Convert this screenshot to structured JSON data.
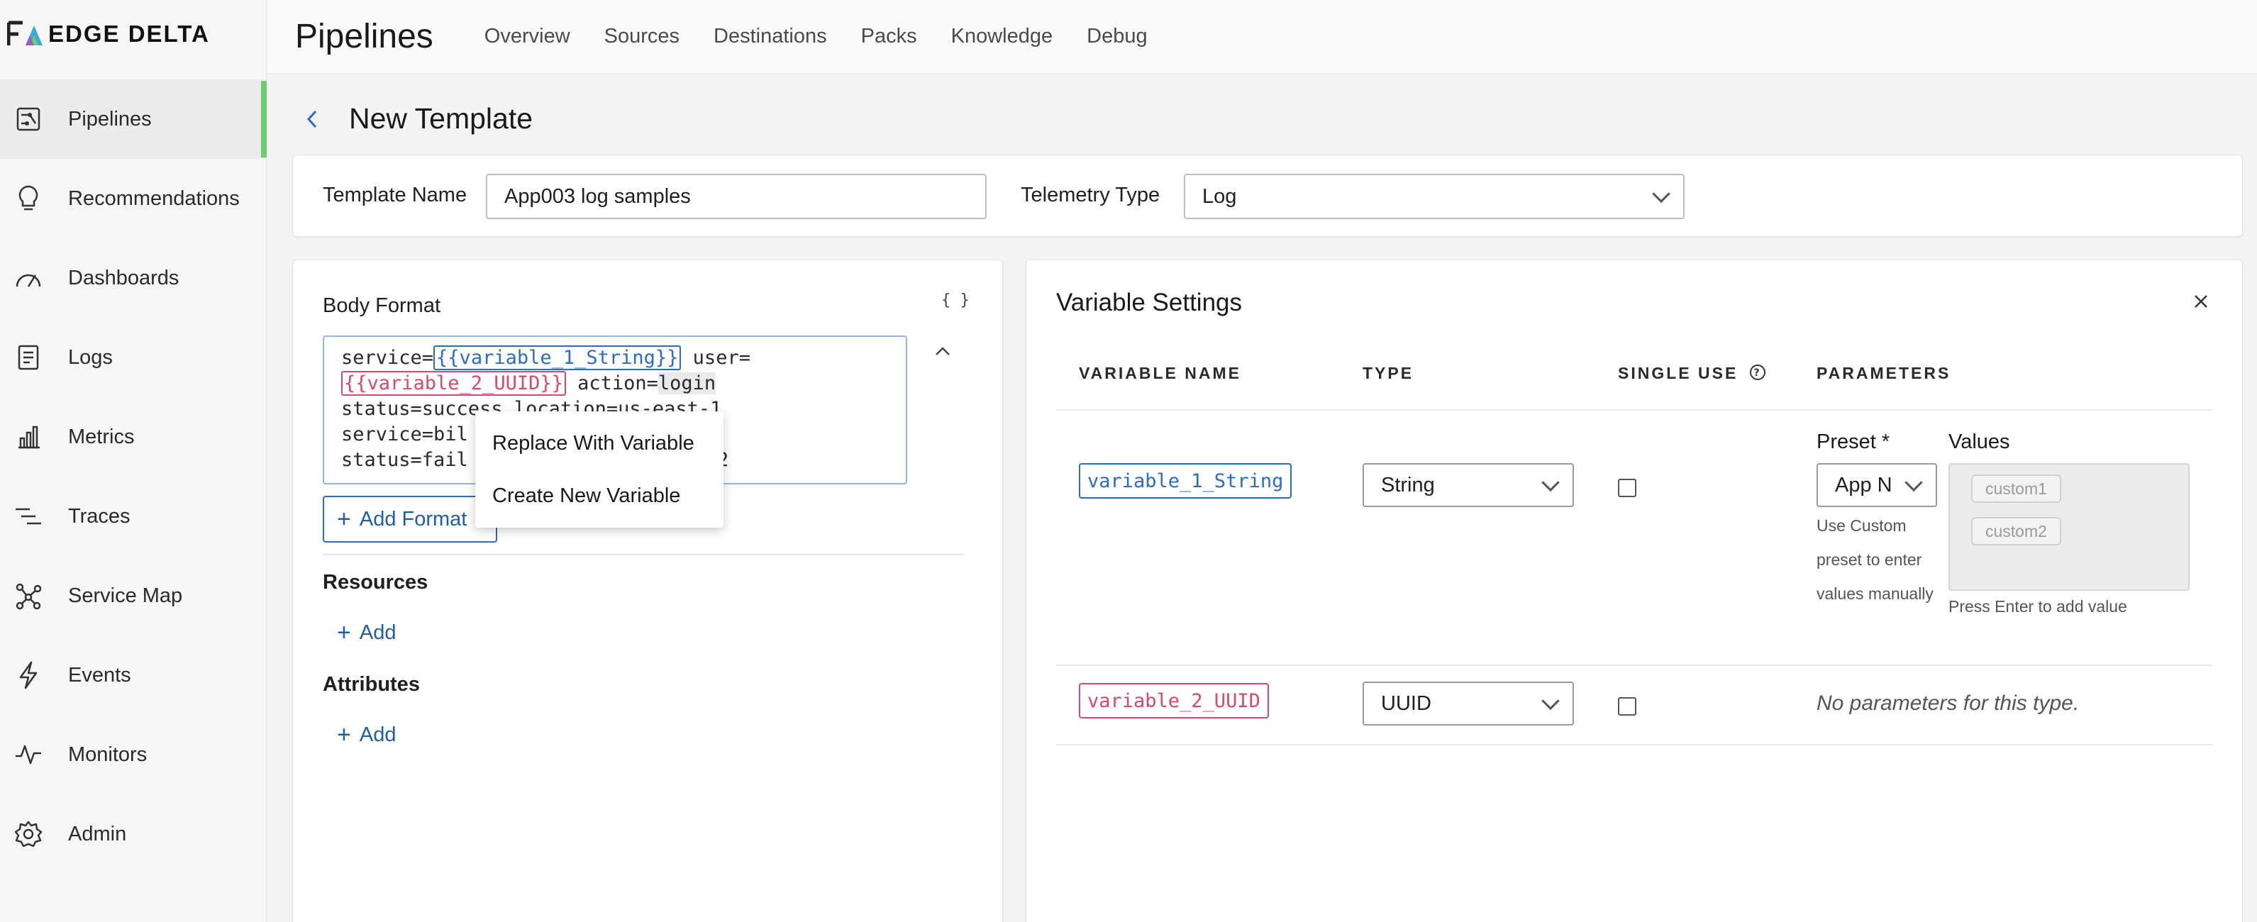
{
  "brand": {
    "logo_text": "EDGE DELTA"
  },
  "sidebar": {
    "items": [
      {
        "label": "Pipelines",
        "icon": "pipelines-icon",
        "active": true
      },
      {
        "label": "Recommendations",
        "icon": "lightbulb-icon"
      },
      {
        "label": "Dashboards",
        "icon": "gauge-icon"
      },
      {
        "label": "Logs",
        "icon": "logs-icon"
      },
      {
        "label": "Metrics",
        "icon": "bar-chart-icon"
      },
      {
        "label": "Traces",
        "icon": "traces-icon"
      },
      {
        "label": "Service Map",
        "icon": "service-map-icon"
      },
      {
        "label": "Events",
        "icon": "lightning-icon"
      },
      {
        "label": "Monitors",
        "icon": "pulse-icon"
      },
      {
        "label": "Admin",
        "icon": "gear-icon"
      }
    ]
  },
  "header": {
    "title": "Pipelines",
    "tabs": [
      "Overview",
      "Sources",
      "Destinations",
      "Packs",
      "Knowledge",
      "Debug"
    ]
  },
  "page": {
    "title": "New Template"
  },
  "template": {
    "name_label": "Template Name",
    "name_value": "App003 log samples",
    "telemetry_label": "Telemetry Type",
    "telemetry_value": "Log"
  },
  "body_format": {
    "label": "Body Format",
    "braces": "{ }",
    "lines": {
      "l1_pre": "service=",
      "l1_var": "{{variable_1_String}}",
      "l1_post": " user=",
      "l2_var": "{{variable_2_UUID}}",
      "l2_post": " action=",
      "l2_hl": "login",
      "l3": "status=success location=us-east-1",
      "l4": "service=bil",
      "l5": "status=fail",
      "l5_end": "2"
    },
    "add_format_label": "Add Format"
  },
  "resources": {
    "label": "Resources",
    "add_label": "Add"
  },
  "attributes": {
    "label": "Attributes",
    "add_label": "Add"
  },
  "context_menu": {
    "items": [
      "Replace With Variable",
      "Create New Variable"
    ]
  },
  "variable_settings": {
    "title": "Variable Settings",
    "columns": [
      "VARIABLE NAME",
      "TYPE",
      "SINGLE USE",
      "PARAMETERS"
    ],
    "rows": [
      {
        "name": "variable_1_String",
        "type": "String",
        "single_use": false,
        "preset_label": "Preset *",
        "preset_value": "App N",
        "preset_hint": "Use Custom preset to enter values manually",
        "values_label": "Values",
        "values": [
          "custom1",
          "custom2"
        ],
        "values_hint": "Press Enter to add value"
      },
      {
        "name": "variable_2_UUID",
        "type": "UUID",
        "single_use": false,
        "no_params": "No parameters for this type."
      }
    ]
  },
  "colors": {
    "accent_blue": "#2b6cc4",
    "accent_pink": "#d9486d",
    "active_green": "#6ccf6f"
  }
}
